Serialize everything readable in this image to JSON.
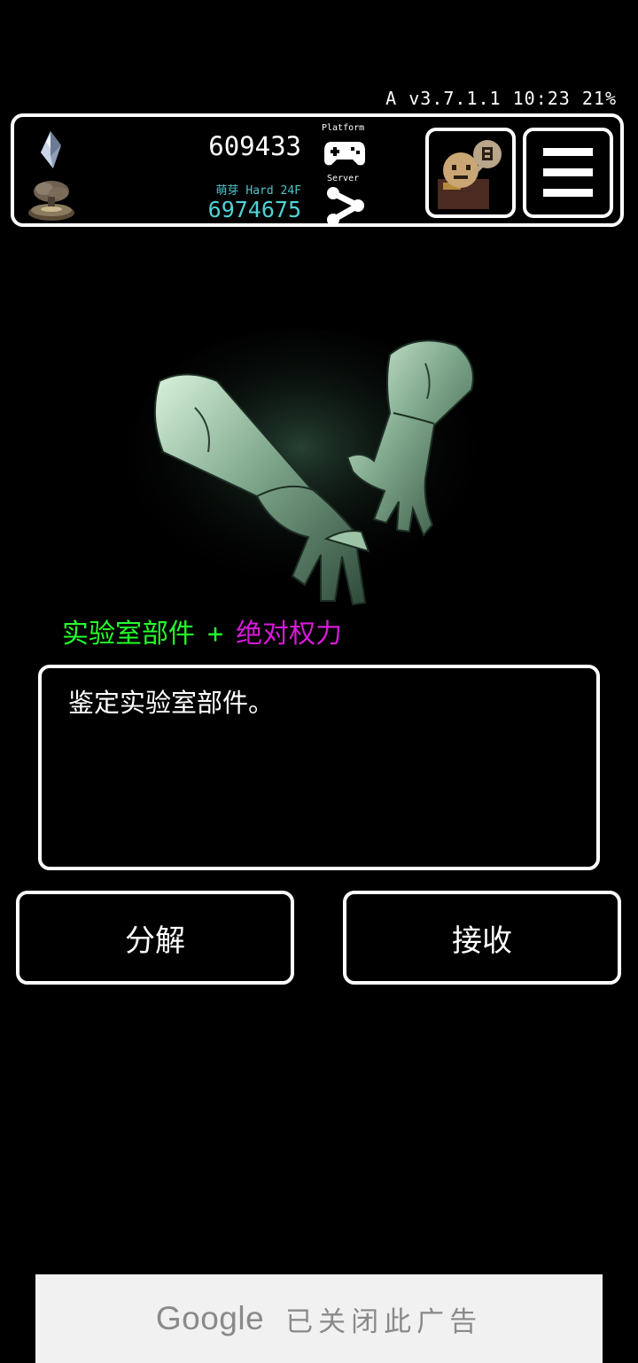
{
  "status_bar": {
    "text": "A v3.7.1.1 10:23 21%"
  },
  "header": {
    "gem_count": "609433",
    "difficulty": "萌芽 Hard 24F",
    "gold_count": "6974675",
    "platform_label": "Platform",
    "server_label": "Server",
    "icons": {
      "gem": "crystal-gem-icon",
      "gold": "gold-pile-icon",
      "platform": "gamepad-icon",
      "server": "share-icon",
      "npc": "npc-portrait-icon",
      "menu": "hamburger-menu-icon"
    }
  },
  "item": {
    "art": "gauntlets-icon",
    "type_label": "实验室部件",
    "plus": "+",
    "attribute_label": "绝对权力",
    "colors": {
      "type": "#25ff2c",
      "attribute": "#d51bd9"
    }
  },
  "dialog": {
    "text": "鉴定实验室部件。"
  },
  "actions": {
    "dismantle_label": "分解",
    "receive_label": "接收"
  },
  "ad": {
    "logo": "Google",
    "text": "已关闭此广告"
  }
}
